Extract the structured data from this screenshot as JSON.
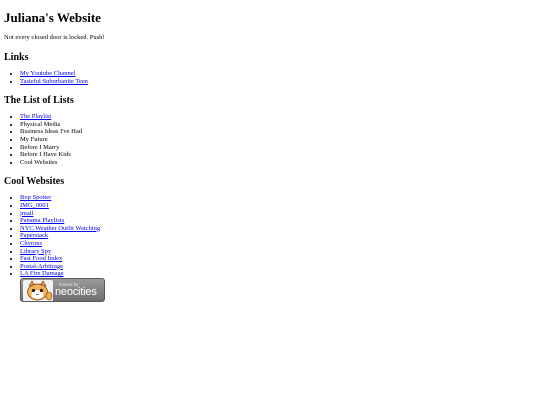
{
  "site": {
    "title": "Juliana's Website",
    "tagline": "Not every closed door is locked. Push!"
  },
  "links": {
    "heading": "Links",
    "items": [
      {
        "label": "My Youtube Channel",
        "link": true
      },
      {
        "label": "Tasteful Suburbanite Teen",
        "link": true
      }
    ]
  },
  "lists": {
    "heading": "The List of Lists",
    "items": [
      {
        "label": "The Playlist",
        "link": true
      },
      {
        "label": "Physical Media",
        "link": false
      },
      {
        "label": "Business Ideas I've Had",
        "link": false
      },
      {
        "label": "My Future",
        "link": false
      },
      {
        "label": "Before I Marry",
        "link": false
      },
      {
        "label": "Before I Have Kids",
        "link": false
      },
      {
        "label": "Cool Websites",
        "link": false
      }
    ]
  },
  "cool": {
    "heading": "Cool Websites",
    "items": [
      {
        "label": "Bop Spotter",
        "link": true
      },
      {
        "label": "IMG_0001",
        "link": true
      },
      {
        "label": "jmail",
        "link": true
      },
      {
        "label": "Panama Playlists",
        "link": true
      },
      {
        "label": "NYC Weather Outfit Watching",
        "link": true
      },
      {
        "label": "Paperstack",
        "link": true
      },
      {
        "label": "Chyrons",
        "link": true
      },
      {
        "label": "Library Spy",
        "link": true
      },
      {
        "label": "Fast Food Index",
        "link": true
      },
      {
        "label": "Postal-Arbitrage",
        "link": true
      },
      {
        "label": "LA Fire Damage",
        "link": true
      }
    ]
  },
  "badge": {
    "hosted_text": "hosted by",
    "brand_text": "neocities",
    "icon": "neocities-cat-icon"
  },
  "colors": {
    "link": "#0000ee",
    "text": "#000000",
    "badge_bg": "#7e7e7e"
  }
}
